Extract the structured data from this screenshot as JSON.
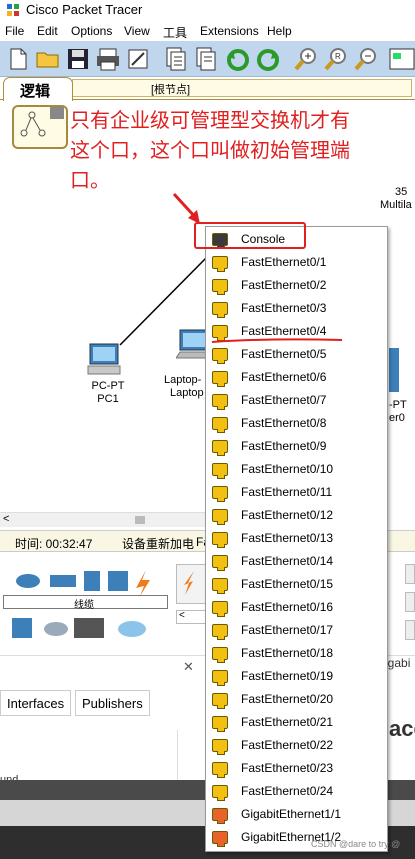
{
  "window": {
    "title": "Cisco Packet Tracer"
  },
  "menu": [
    "File",
    "Edit",
    "Options",
    "View",
    "工具",
    "Extensions",
    "Help"
  ],
  "workspace": {
    "tab_label": "逻辑",
    "root_node": "[根节点]"
  },
  "annotation": {
    "line1": "只有企业级可管理型交换机才有",
    "line2": "这个口，这个口叫做初始管理端",
    "line3": "口。"
  },
  "devices": {
    "pc": {
      "type": "PC-PT",
      "name": "PC1"
    },
    "laptop": {
      "type": "Laptop-",
      "name": "Laptop"
    },
    "switch": {
      "model": "35",
      "type": "Multila"
    },
    "router": {
      "type": "-PT",
      "name": "er0"
    }
  },
  "status": {
    "time": "时间: 00:32:47",
    "event": "设备重新加电",
    "tail": "Fa"
  },
  "device_panel": {
    "category_label": "线缆"
  },
  "bottom": {
    "tabs": [
      "Interfaces",
      "Publishers"
    ],
    "right_text": "igabi",
    "right_big": "ace",
    "left_text": "und",
    "close": "✕"
  },
  "ports": [
    {
      "label": "Console",
      "kind": "console"
    },
    {
      "label": "FastEthernet0/1",
      "kind": "fast"
    },
    {
      "label": "FastEthernet0/2",
      "kind": "fast"
    },
    {
      "label": "FastEthernet0/3",
      "kind": "fast"
    },
    {
      "label": "FastEthernet0/4",
      "kind": "fast"
    },
    {
      "label": "FastEthernet0/5",
      "kind": "fast"
    },
    {
      "label": "FastEthernet0/6",
      "kind": "fast"
    },
    {
      "label": "FastEthernet0/7",
      "kind": "fast"
    },
    {
      "label": "FastEthernet0/8",
      "kind": "fast"
    },
    {
      "label": "FastEthernet0/9",
      "kind": "fast"
    },
    {
      "label": "FastEthernet0/10",
      "kind": "fast"
    },
    {
      "label": "FastEthernet0/11",
      "kind": "fast"
    },
    {
      "label": "FastEthernet0/12",
      "kind": "fast"
    },
    {
      "label": "FastEthernet0/13",
      "kind": "fast"
    },
    {
      "label": "FastEthernet0/14",
      "kind": "fast"
    },
    {
      "label": "FastEthernet0/15",
      "kind": "fast"
    },
    {
      "label": "FastEthernet0/16",
      "kind": "fast"
    },
    {
      "label": "FastEthernet0/17",
      "kind": "fast"
    },
    {
      "label": "FastEthernet0/18",
      "kind": "fast"
    },
    {
      "label": "FastEthernet0/19",
      "kind": "fast"
    },
    {
      "label": "FastEthernet0/20",
      "kind": "fast"
    },
    {
      "label": "FastEthernet0/21",
      "kind": "fast"
    },
    {
      "label": "FastEthernet0/22",
      "kind": "fast"
    },
    {
      "label": "FastEthernet0/23",
      "kind": "fast"
    },
    {
      "label": "FastEthernet0/24",
      "kind": "fast"
    },
    {
      "label": "GigabitEthernet1/1",
      "kind": "gig"
    },
    {
      "label": "GigabitEthernet1/2",
      "kind": "gig"
    }
  ],
  "colors": {
    "console": "#3a3a3a",
    "fast": "#f2c010",
    "gig": "#e8632a",
    "accent": "#e02020"
  },
  "watermark": "CSDN @dare to try @"
}
